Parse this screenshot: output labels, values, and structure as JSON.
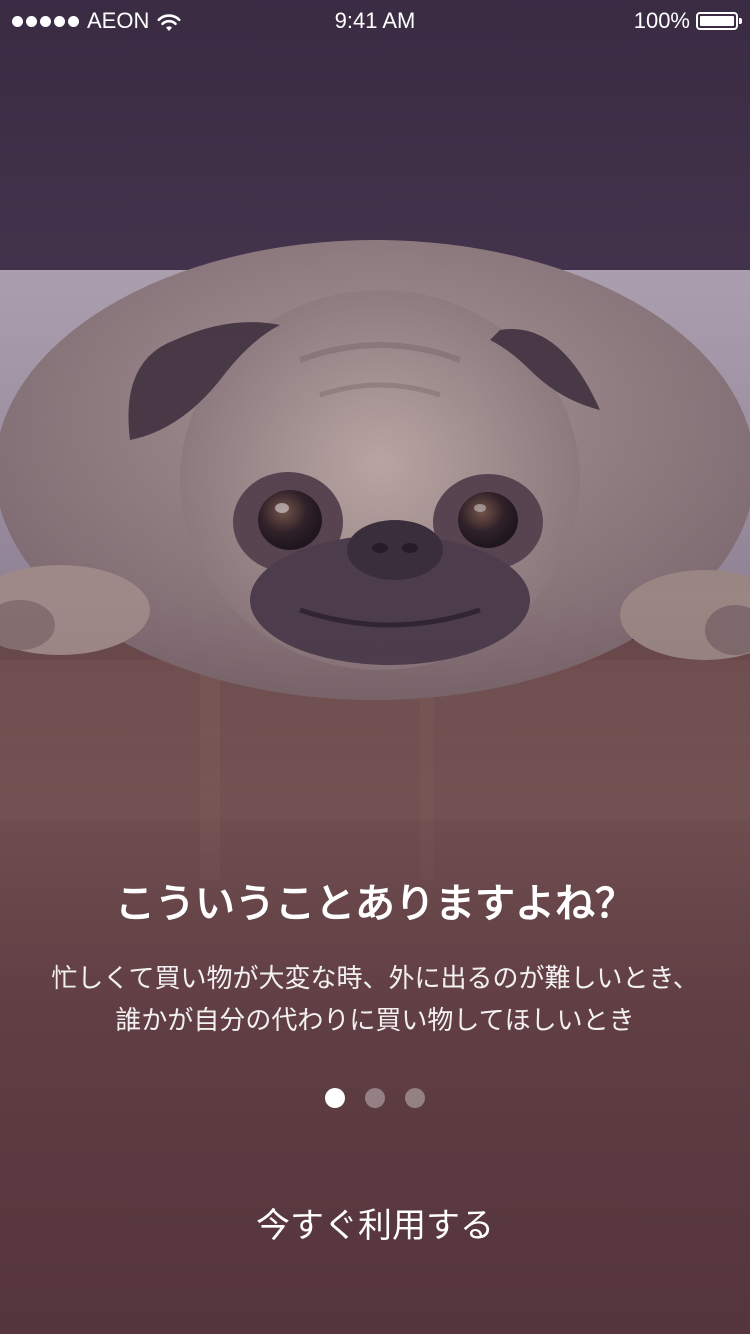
{
  "status_bar": {
    "signal_bars": 5,
    "carrier": "AEON",
    "network_icon": "wifi-icon",
    "time": "9:41 AM",
    "battery_percent": "100%",
    "battery_level": 1.0
  },
  "background": {
    "subject": "pug-photo",
    "overlay_color": "#5a3c46"
  },
  "onboarding": {
    "headline": "こういうことありますよね？",
    "description": "忙しくて買い物が大変な時、外に出るのが難しいとき、誰かが自分の代わりに買い物してほしいとき",
    "page_indicator": {
      "count": 3,
      "active_index": 0
    },
    "cta_label": "今すぐ利用する"
  },
  "colors": {
    "text_primary": "#ffffff",
    "indicator_inactive": "rgba(255,255,255,0.35)",
    "indicator_active": "#ffffff"
  }
}
